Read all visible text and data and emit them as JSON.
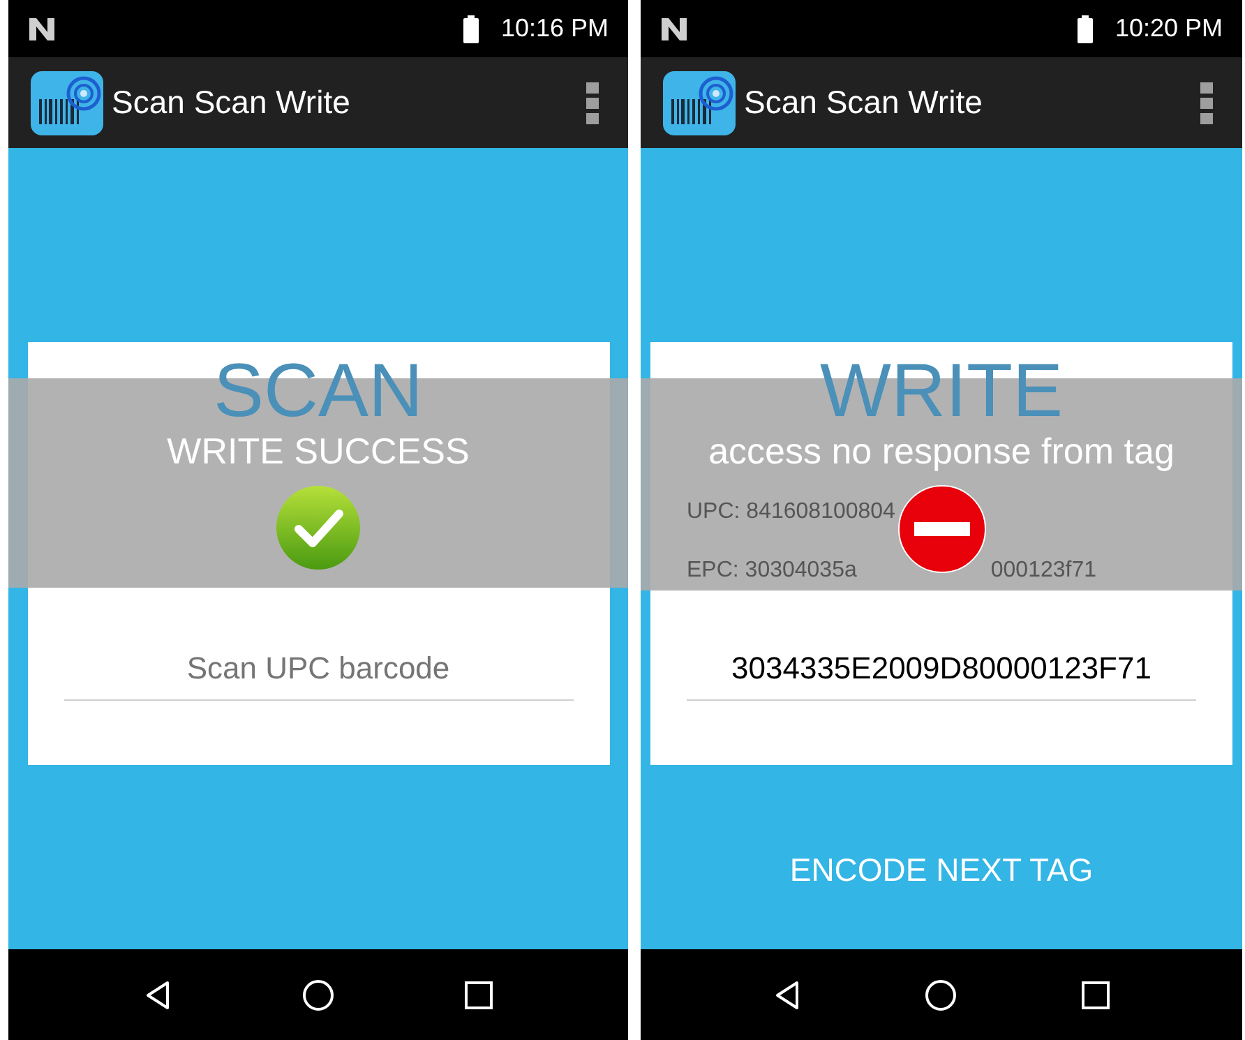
{
  "screens": [
    {
      "status_time": "10:16 PM",
      "app_title": "Scan Scan Write",
      "card": {
        "heading": "SCAN",
        "items": [
          {
            "kind": "field",
            "placeholder": "Scan UPC barcode"
          }
        ]
      },
      "toast": {
        "message": "WRITE SUCCESS",
        "kind": "success"
      }
    },
    {
      "status_time": "10:20 PM",
      "app_title": "Scan Scan Write",
      "card": {
        "heading": "WRITE",
        "items": [
          {
            "kind": "line",
            "parts": [
              "UPC: 841608100804"
            ]
          },
          {
            "kind": "line",
            "parts": [
              "EPC: 30304035a",
              "000123f71"
            ]
          },
          {
            "kind": "field",
            "value": "3034335E2009D80000123F71"
          }
        ]
      },
      "toast": {
        "message": "access no response from tag",
        "kind": "error"
      },
      "button": "ENCODE NEXT TAG"
    }
  ]
}
